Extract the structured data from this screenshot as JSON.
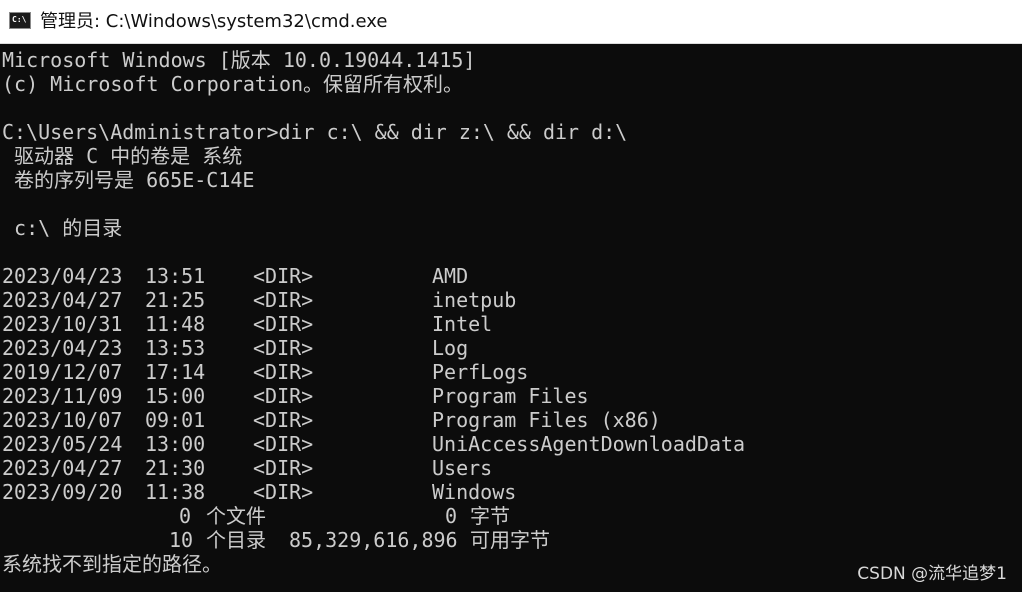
{
  "window": {
    "icon": "cmd-icon",
    "icon_text": "C:\\",
    "title": "管理员: C:\\Windows\\system32\\cmd.exe"
  },
  "console": {
    "header": [
      "Microsoft Windows [版本 10.0.19044.1415]",
      "(c) Microsoft Corporation。保留所有权利。"
    ],
    "prompt": "C:\\Users\\Administrator>dir c:\\ && dir z:\\ && dir d:\\",
    "volume_line": " 驱动器 C 中的卷是 系统",
    "serial_line": " 卷的序列号是 665E-C14E",
    "dir_heading": " c:\\ 的目录",
    "entries": [
      {
        "date": "2023/04/23",
        "time": "13:51",
        "type": "<DIR>",
        "name": "AMD"
      },
      {
        "date": "2023/04/27",
        "time": "21:25",
        "type": "<DIR>",
        "name": "inetpub"
      },
      {
        "date": "2023/10/31",
        "time": "11:48",
        "type": "<DIR>",
        "name": "Intel"
      },
      {
        "date": "2023/04/23",
        "time": "13:53",
        "type": "<DIR>",
        "name": "Log"
      },
      {
        "date": "2019/12/07",
        "time": "17:14",
        "type": "<DIR>",
        "name": "PerfLogs"
      },
      {
        "date": "2023/11/09",
        "time": "15:00",
        "type": "<DIR>",
        "name": "Program Files"
      },
      {
        "date": "2023/10/07",
        "time": "09:01",
        "type": "<DIR>",
        "name": "Program Files (x86)"
      },
      {
        "date": "2023/05/24",
        "time": "13:00",
        "type": "<DIR>",
        "name": "UniAccessAgentDownloadData"
      },
      {
        "date": "2023/04/27",
        "time": "21:30",
        "type": "<DIR>",
        "name": "Users"
      },
      {
        "date": "2023/09/20",
        "time": "11:38",
        "type": "<DIR>",
        "name": "Windows"
      }
    ],
    "summary_files": {
      "count": "0",
      "count_label": "个文件",
      "bytes": "0",
      "bytes_label": "字节"
    },
    "summary_dirs": {
      "count": "10",
      "count_label": "个目录",
      "bytes": "85,329,616,896",
      "bytes_label": "可用字节"
    },
    "error": "系统找不到指定的路径。"
  },
  "watermark": "CSDN @流华追梦1",
  "colors": {
    "console_bg": "#0c0c0c",
    "console_text": "#cccccc",
    "titlebar_bg": "#ffffff"
  }
}
